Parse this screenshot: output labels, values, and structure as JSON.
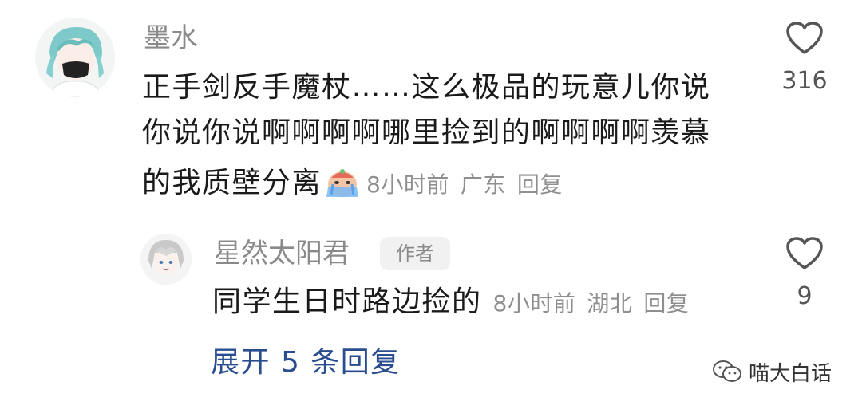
{
  "comment": {
    "username": "墨水",
    "text_line1": "正手剑反手魔杖……这么极品的玩意儿你说",
    "text_line2": "你说你说啊啊啊啊哪里捡到的啊啊啊啊羡慕",
    "text_line3": "的我质壁分离",
    "emoji": "crying-face-emoji",
    "time": "8小时前",
    "location": "广东",
    "reply_label": "回复",
    "like_count": "316",
    "like_icon": "heart-outline-icon"
  },
  "reply": {
    "username": "星然太阳君",
    "badge": "作者",
    "text": "同学生日时路边捡的",
    "time": "8小时前",
    "location": "湖北",
    "reply_label": "回复",
    "like_count": "9",
    "like_icon": "heart-outline-icon"
  },
  "expand_label": "展开 5 条回复",
  "watermark": {
    "text": "喵大白话",
    "icon": "wechat-icon"
  },
  "colors": {
    "text": "#1a1a1a",
    "meta": "#8f8f8f",
    "link": "#2a4d8f",
    "badge_bg": "#f1f1f1"
  }
}
